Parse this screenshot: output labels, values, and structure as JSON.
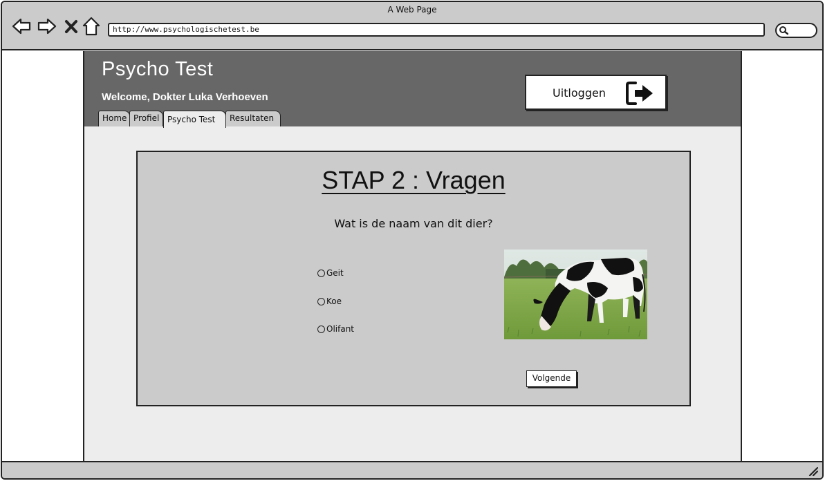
{
  "window": {
    "title": "A Web Page"
  },
  "browser": {
    "url": "http://www.psychologischetest.be",
    "icons": [
      "back-icon",
      "forward-icon",
      "close-icon",
      "home-icon",
      "search-icon"
    ]
  },
  "header": {
    "brand": "Psycho Test",
    "welcome": "Welcome, Dokter Luka Verhoeven",
    "logout_label": "Uitloggen",
    "logout_icon": "logout-arrow-icon"
  },
  "tabs": [
    {
      "label": "Home",
      "active": false
    },
    {
      "label": "Profiel",
      "active": false
    },
    {
      "label": "Psycho Test",
      "active": true
    },
    {
      "label": "Resultaten",
      "active": false
    }
  ],
  "main": {
    "step_title": "STAP 2 : Vragen",
    "question": "Wat is de naam van dit dier?",
    "options": [
      {
        "label": "Geit",
        "selected": false
      },
      {
        "label": "Koe",
        "selected": false
      },
      {
        "label": "Olifant",
        "selected": false
      }
    ],
    "image_subject": "cow grazing in a meadow",
    "next_label": "Volgende"
  },
  "colors": {
    "chrome": "#cbcbcb",
    "header": "#676767",
    "page_bg": "#ededed",
    "content_bg": "#cbcbcb"
  }
}
